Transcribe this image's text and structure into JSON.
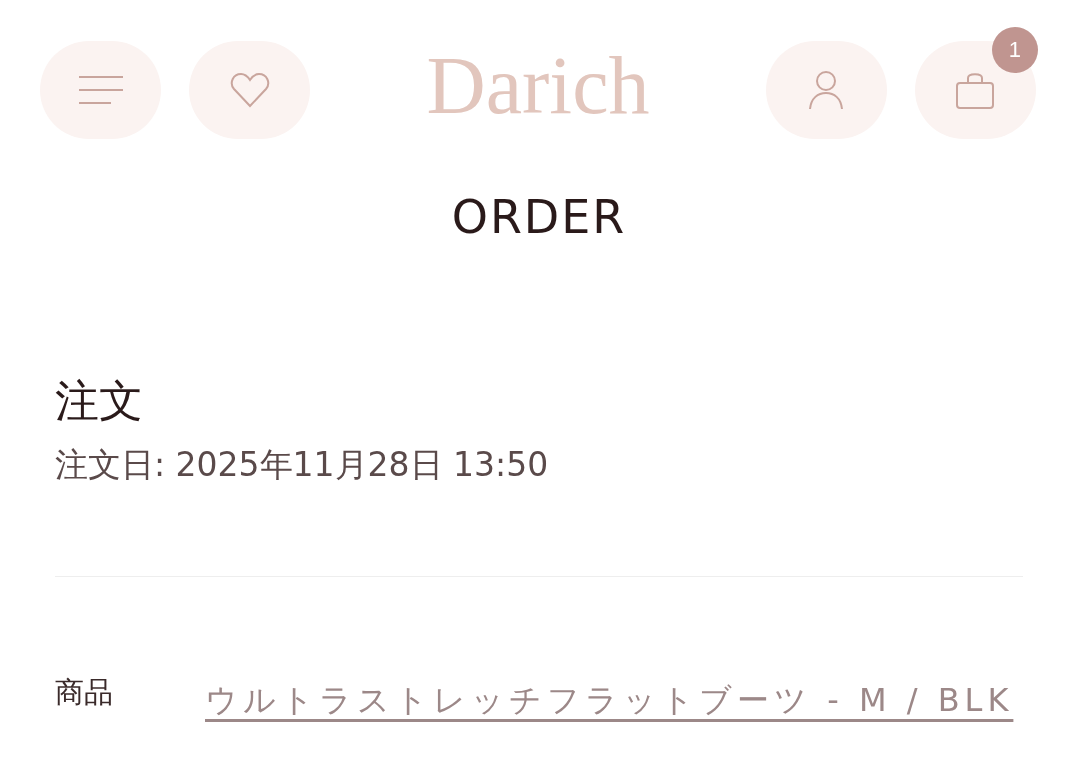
{
  "header": {
    "left_buttons": [
      {
        "kind": "menu"
      },
      {
        "kind": "heart"
      }
    ],
    "logo": "Darich",
    "right_buttons": [
      {
        "kind": "user"
      },
      {
        "kind": "bag",
        "badge": "1"
      }
    ]
  },
  "page_title": "ORDER",
  "order": {
    "heading": "注文",
    "date": "注文日: 2025年11月28日 13:50"
  },
  "details": [
    {
      "label": "商品",
      "value": "ウルトラストレッチフラットブーツ - M / BLK"
    }
  ]
}
